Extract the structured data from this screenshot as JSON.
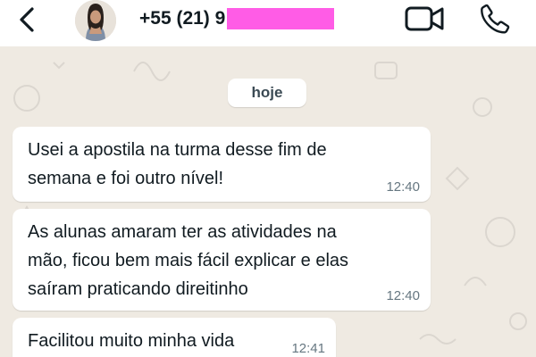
{
  "header": {
    "contact_number": "+55 (21) 9",
    "icons": {
      "back": "arrow-back-icon",
      "video": "video-call-icon",
      "call": "phone-call-icon"
    }
  },
  "date_separator": "hoje",
  "messages": [
    {
      "text": "Usei a apostila na turma desse fim de\nsemana e foi outro nível!",
      "time": "12:40"
    },
    {
      "text": "As alunas amaram ter as atividades na\nmão, ficou bem mais fácil explicar e elas\nsaíram praticando direitinho",
      "time": "12:40"
    },
    {
      "text": "Facilitou muito minha vida",
      "time": "12:41"
    }
  ],
  "colors": {
    "background": "#efeae2",
    "bubble": "#ffffff",
    "redaction": "#ff5ce6",
    "text": "#111b21",
    "time": "#667781"
  }
}
